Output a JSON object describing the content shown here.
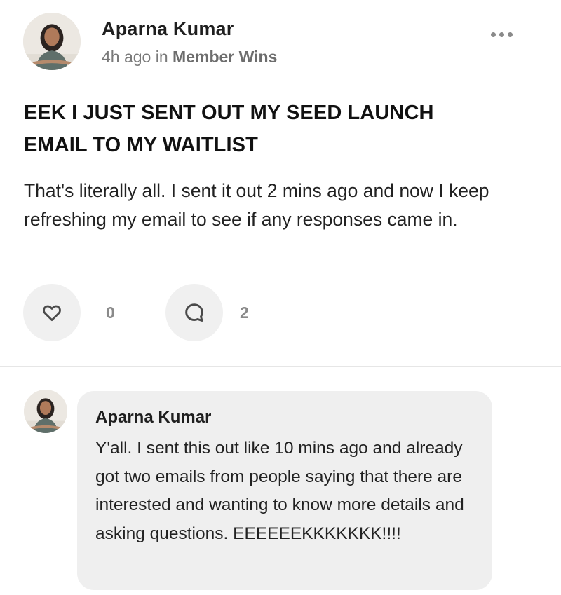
{
  "post": {
    "author": "Aparna Kumar",
    "time": "4h ago",
    "in_text": "in",
    "space": "Member Wins",
    "more_icon": "more-horizontal-icon",
    "title_line1": "EEK I JUST SENT OUT MY SEED LAUNCH",
    "title_line2": "EMAIL TO MY WAITLIST",
    "body": "That's literally all. I sent it out 2 mins ago and now I keep refreshing my email to see if any responses came in.",
    "likes": {
      "icon": "heart-icon",
      "count": "0"
    },
    "comments": {
      "icon": "comment-icon",
      "count": "2"
    }
  },
  "comment": {
    "author": "Aparna Kumar",
    "text": "Y'all. I sent this out like 10 mins ago and already got two emails from people saying that there are interested and wanting to know more details and asking questions. EEEEEEKKKKKKK!!!!"
  },
  "colors": {
    "meta": "#7a7a7a",
    "action_bg": "#f0f0f0",
    "bubble_bg": "#efefef",
    "icon": "#4a4a4a"
  }
}
